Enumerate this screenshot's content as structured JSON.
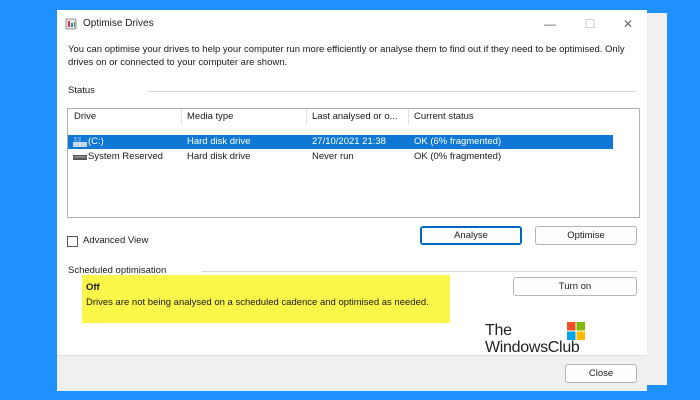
{
  "window": {
    "title": "Optimise Drives",
    "minimize_glyph": "—",
    "maximize_glyph": "☐",
    "close_glyph": "✕"
  },
  "intro_text": "You can optimise your drives to help your computer run more efficiently or analyse them to find out if they need to be optimised. Only drives on or connected to your computer are shown.",
  "status": {
    "label": "Status",
    "columns": [
      "Drive",
      "Media type",
      "Last analysed or o...",
      "Current status"
    ],
    "rows": [
      {
        "drive": "(C:)",
        "icon": "windows-drive-icon",
        "media_type": "Hard disk drive",
        "last_analysed": "27/10/2021 21:38",
        "current_status": "OK (6% fragmented)",
        "selected": true
      },
      {
        "drive": "System Reserved",
        "icon": "hard-drive-icon",
        "media_type": "Hard disk drive",
        "last_analysed": "Never run",
        "current_status": "OK (0% fragmented)",
        "selected": false
      }
    ]
  },
  "advanced_view": {
    "label": "Advanced View",
    "checked": false
  },
  "buttons": {
    "analyse": "Analyse",
    "optimise": "Optimise",
    "turn_on": "Turn on",
    "close": "Close"
  },
  "scheduled": {
    "label": "Scheduled optimisation",
    "state": "Off",
    "description": "Drives are not being analysed on a scheduled cadence and optimised as needed."
  },
  "watermark": {
    "line1": "The",
    "line2": "WindowsClub"
  },
  "colors": {
    "selection": "#0f78d4",
    "highlight": "#fbf74a",
    "background": "#1e90ff"
  }
}
